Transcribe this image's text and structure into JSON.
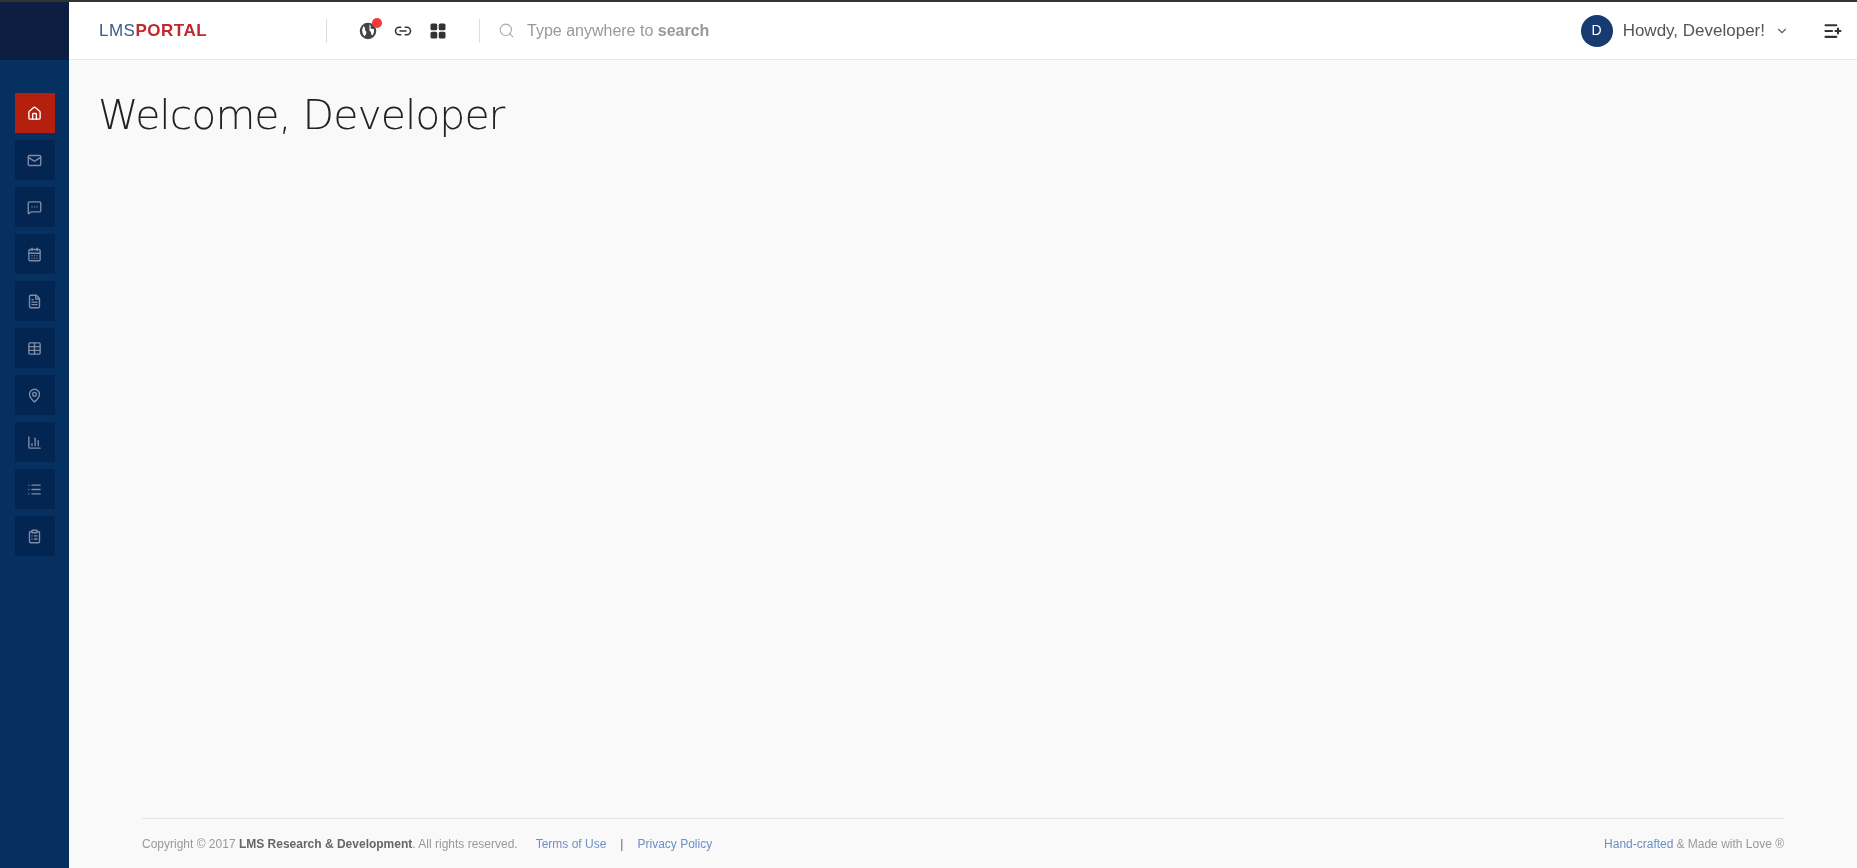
{
  "brand": {
    "prefix": "LMS",
    "suffix": "PORTAL"
  },
  "toolbar": {
    "notification_dot": true
  },
  "search": {
    "placeholder": "Type anywhere to **search**"
  },
  "user": {
    "initial": "D",
    "greeting": "Howdy, Developer!"
  },
  "sidebar": {
    "items": [
      {
        "selected": true
      },
      {
        "selected": false
      },
      {
        "selected": false
      },
      {
        "selected": false
      },
      {
        "selected": false
      },
      {
        "selected": false
      },
      {
        "selected": false
      },
      {
        "selected": false
      },
      {
        "selected": false
      },
      {
        "selected": false
      }
    ]
  },
  "page": {
    "title": "Welcome, Developer"
  },
  "footer": {
    "copyright": "Copyright © 2017 **LMS Research & Development**. All rights reserved.",
    "links": [
      "Terms of Use",
      "Privacy Policy"
    ],
    "separator": "|",
    "credit_link": "Hand-crafted",
    "credit_text": "& Made with Love ®"
  }
}
